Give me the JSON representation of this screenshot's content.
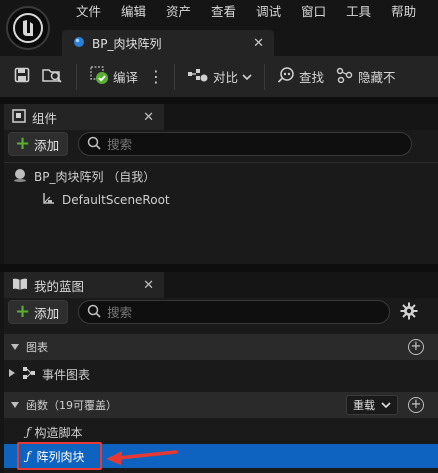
{
  "menu": [
    "文件",
    "编辑",
    "资产",
    "查看",
    "调试",
    "窗口",
    "工具",
    "帮助"
  ],
  "document_tab": {
    "title": "BP_肉块阵列"
  },
  "toolbar": {
    "compile_label": "编译",
    "diff_label": "对比",
    "find_label": "查找",
    "hide_label": "隐藏不"
  },
  "components_panel": {
    "title": "组件",
    "add_label": "添加",
    "search_placeholder": "搜索",
    "tree": [
      {
        "label": "BP_肉块阵列 （自我）",
        "icon": "actor-sphere-icon"
      },
      {
        "label": "DefaultSceneRoot",
        "icon": "scene-root-icon"
      }
    ]
  },
  "my_blueprint_panel": {
    "title": "我的蓝图",
    "add_label": "添加",
    "search_placeholder": "搜索",
    "graphs_header": "图表",
    "event_graph_label": "事件图表",
    "functions_header": "函数（19可覆盖）",
    "override_label": "重载",
    "functions": [
      {
        "label": "构造脚本",
        "icon": "function-icon",
        "selected": false
      },
      {
        "label": "阵列肉块",
        "icon": "function-icon",
        "selected": true
      }
    ]
  },
  "colors": {
    "accent_add": "#5ab034",
    "selection": "#0e63c0",
    "annotation_red": "#e53935"
  }
}
